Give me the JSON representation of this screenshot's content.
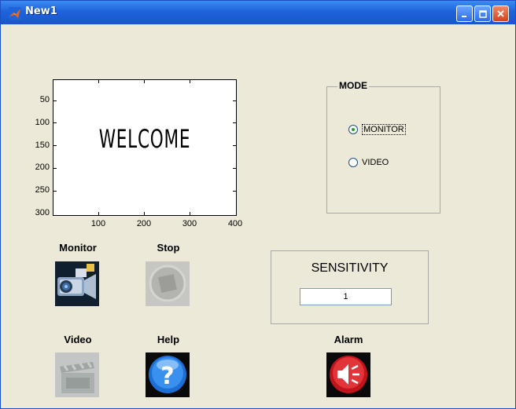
{
  "window": {
    "title": "New1"
  },
  "axes": {
    "y_ticks": [
      "50",
      "100",
      "150",
      "200",
      "250",
      "300"
    ],
    "x_ticks": [
      "100",
      "200",
      "300",
      "400"
    ],
    "display_text": "WELCOME"
  },
  "mode": {
    "title": "MODE",
    "options": [
      {
        "label": "MONITOR",
        "selected": true
      },
      {
        "label": "VIDEO",
        "selected": false
      }
    ]
  },
  "sensitivity": {
    "title": "SENSITIVITY",
    "value": "1"
  },
  "buttons": {
    "monitor": {
      "label": "Monitor",
      "icon": "video-camera-icon",
      "enabled": true
    },
    "stop": {
      "label": "Stop",
      "icon": "stop-icon",
      "enabled": false
    },
    "video": {
      "label": "Video",
      "icon": "clapperboard-icon",
      "enabled": false
    },
    "help": {
      "label": "Help",
      "icon": "question-mark-icon",
      "enabled": true
    },
    "alarm": {
      "label": "Alarm",
      "icon": "speaker-icon",
      "enabled": true
    }
  }
}
